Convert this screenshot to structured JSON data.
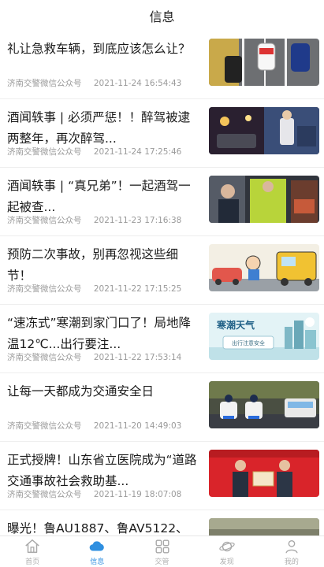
{
  "header": {
    "title": "信息"
  },
  "news": [
    {
      "title": "礼让急救车辆，到底应该怎么让？",
      "source": "济南交警微信公众号",
      "time": "2021-11-24 16:54:43",
      "image": "ambulance-road"
    },
    {
      "title": "酒闻轶事 | 必须严惩！！醉驾被逮两整年，再次醉驾...",
      "source": "济南交警微信公众号",
      "time": "2021-11-24 17:25:46",
      "image": "night-police-check"
    },
    {
      "title": "酒闻轶事 | “真兄弟”！一起酒驾一起被查...",
      "source": "济南交警微信公众号",
      "time": "2021-11-23 17:16:38",
      "image": "police-checkpoint"
    },
    {
      "title": "预防二次事故，别再忽视这些细节！",
      "source": "济南交警微信公众号",
      "time": "2021-11-22 17:15:25",
      "image": "cartoon-accident"
    },
    {
      "title": "“速冻式”寒潮到家门口了！局地降温12℃...出行要注...",
      "source": "济南交警微信公众号",
      "time": "2021-11-22 17:53:14",
      "image": "cold-wave-poster",
      "image_text": "寒潮天气",
      "image_subtext": "出行注意安全"
    },
    {
      "title": "让每一天都成为交通安全日",
      "source": "济南交警微信公众号",
      "time": "2021-11-20 14:49:03",
      "image": "police-motorcycles"
    },
    {
      "title": "正式授牌！山东省立医院成为“道路交通事故社会救助基...",
      "source": "济南交警微信公众号",
      "time": "2021-11-19 18:07:08",
      "image": "award-ceremony"
    },
    {
      "title": "曝光！鲁AU1887、鲁AV5122、",
      "source": "",
      "time": "",
      "image": "partial"
    }
  ],
  "tabbar": {
    "items": [
      {
        "label": "首页",
        "icon": "home-icon",
        "active": false
      },
      {
        "label": "信息",
        "icon": "cloud-icon",
        "active": true
      },
      {
        "label": "交管",
        "icon": "grid-icon",
        "active": false
      },
      {
        "label": "发现",
        "icon": "planet-icon",
        "active": false
      },
      {
        "label": "我的",
        "icon": "user-icon",
        "active": false
      }
    ]
  },
  "colors": {
    "accent": "#2f8fe0",
    "inactive": "#b0b0b0"
  }
}
